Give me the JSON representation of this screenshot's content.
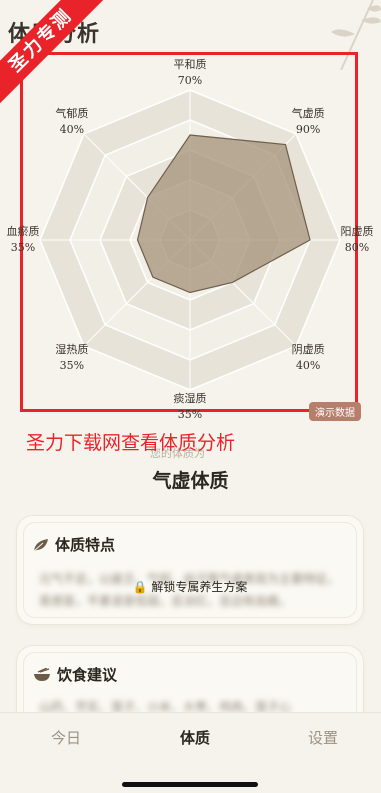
{
  "header": {
    "title": "体质分析",
    "ribbon": "圣力专测"
  },
  "radar": {
    "axes": [
      {
        "name": "平和质",
        "value": "70%"
      },
      {
        "name": "气虚质",
        "value": "90%"
      },
      {
        "name": "阳虚质",
        "value": "80%"
      },
      {
        "name": "阴虚质",
        "value": "40%"
      },
      {
        "name": "痰湿质",
        "value": "35%"
      },
      {
        "name": "湿热质",
        "value": "35%"
      },
      {
        "name": "血瘀质",
        "value": "35%"
      },
      {
        "name": "气郁质",
        "value": "40%"
      }
    ],
    "demo_badge": "演示数据"
  },
  "chart_data": {
    "type": "radar",
    "categories": [
      "平和质",
      "气虚质",
      "阳虚质",
      "阴虚质",
      "痰湿质",
      "湿热质",
      "血瘀质",
      "气郁质"
    ],
    "values": [
      70,
      90,
      80,
      40,
      35,
      35,
      35,
      40
    ],
    "ylim": [
      0,
      100
    ],
    "rings": 5,
    "fill_color": "#a4927a",
    "grid_colors": [
      "#f2efe7",
      "#e8e3d8"
    ]
  },
  "promo": {
    "text": "圣力下载网查看体质分析",
    "caption": "您的体质为"
  },
  "result": {
    "title": "气虚体质"
  },
  "cards": {
    "traits": {
      "title": "体质特点",
      "blurred": "元气不足，以疲乏、气短、自汗等气虚表现为主要特征，易感冒，平素语音低弱，舌淡红，舌边有齿痕。",
      "unlock": "解锁专属养生方案"
    },
    "diet": {
      "title": "饮食建议",
      "blurred": "山药、芡实、莲子、小米、大枣、鸡肉、莲子心"
    }
  },
  "tabs": [
    {
      "label": "今日"
    },
    {
      "label": "体质"
    },
    {
      "label": "设置"
    }
  ],
  "colors": {
    "accent_red": "#e8232a",
    "badge": "#b67e6b"
  }
}
